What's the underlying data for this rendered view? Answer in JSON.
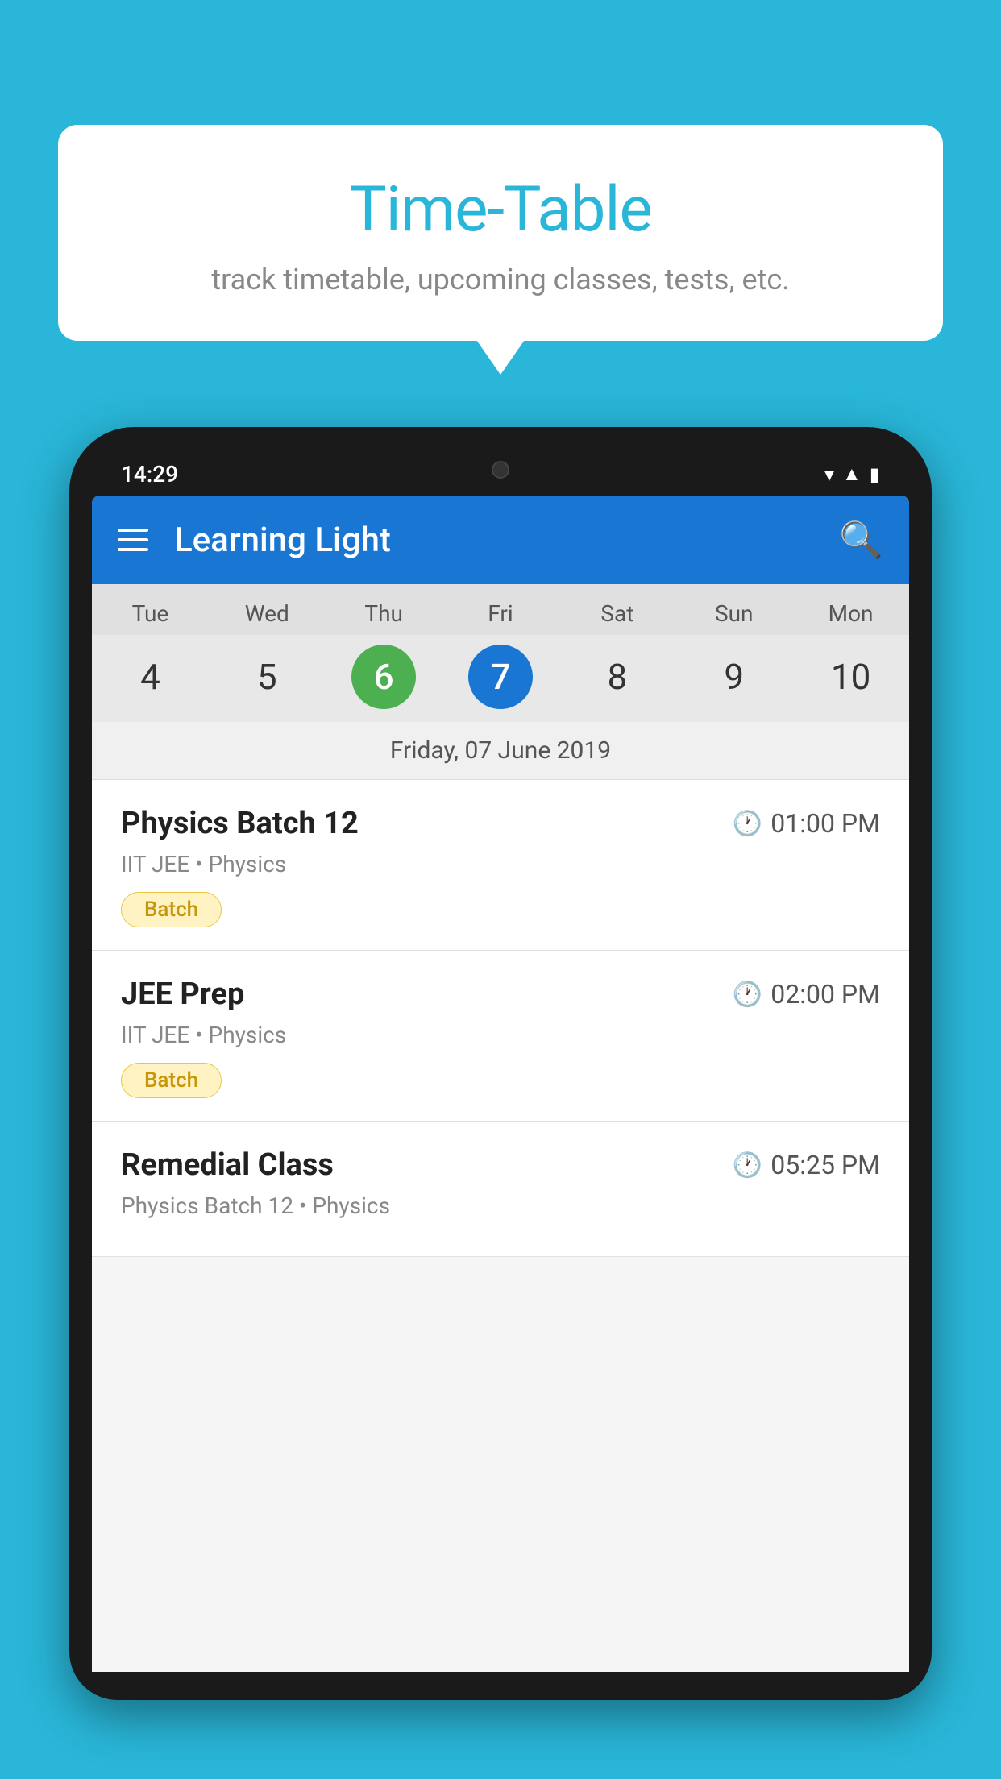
{
  "background_color": "#29B6D8",
  "bubble": {
    "title": "Time-Table",
    "subtitle": "track timetable, upcoming classes, tests, etc."
  },
  "phone": {
    "status_time": "14:29",
    "app_title": "Learning Light",
    "calendar": {
      "day_headers": [
        "Tue",
        "Wed",
        "Thu",
        "Fri",
        "Sat",
        "Sun",
        "Mon"
      ],
      "day_numbers": [
        "4",
        "5",
        "6",
        "7",
        "8",
        "9",
        "10"
      ],
      "today_index": 2,
      "selected_index": 3,
      "selected_date_label": "Friday, 07 June 2019"
    },
    "classes": [
      {
        "name": "Physics Batch 12",
        "time": "01:00 PM",
        "meta": "IIT JEE • Physics",
        "badge": "Batch"
      },
      {
        "name": "JEE Prep",
        "time": "02:00 PM",
        "meta": "IIT JEE • Physics",
        "badge": "Batch"
      },
      {
        "name": "Remedial Class",
        "time": "05:25 PM",
        "meta": "Physics Batch 12 • Physics",
        "badge": null
      }
    ]
  }
}
